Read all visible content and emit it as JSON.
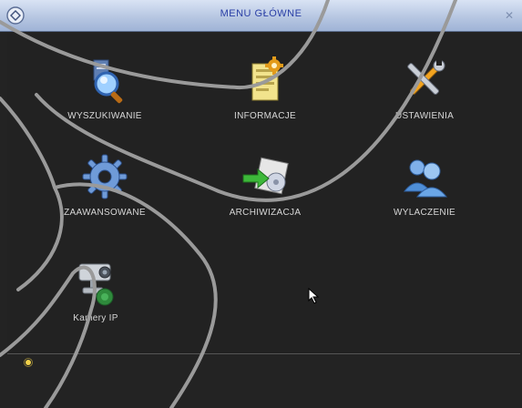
{
  "window": {
    "title": "MENU GŁÓWNE"
  },
  "menu": {
    "items": [
      {
        "label": "WYSZUKIWANIE",
        "icon": "search-icon"
      },
      {
        "label": "INFORMACJE",
        "icon": "info-document-icon"
      },
      {
        "label": "USTAWIENIA",
        "icon": "tools-icon"
      },
      {
        "label": "ZAAWANSOWANE",
        "icon": "gear-icon"
      },
      {
        "label": "ARCHIWIZACJA",
        "icon": "backup-icon"
      },
      {
        "label": "WYLACZENIE",
        "icon": "users-icon"
      },
      {
        "label": "Kamery IP",
        "icon": "ip-camera-icon"
      }
    ]
  },
  "colors": {
    "title_text": "#2a3fa6",
    "background": "#232323",
    "label_text": "#d7d7d7",
    "overlay_stroke": "#9a9a9a"
  }
}
